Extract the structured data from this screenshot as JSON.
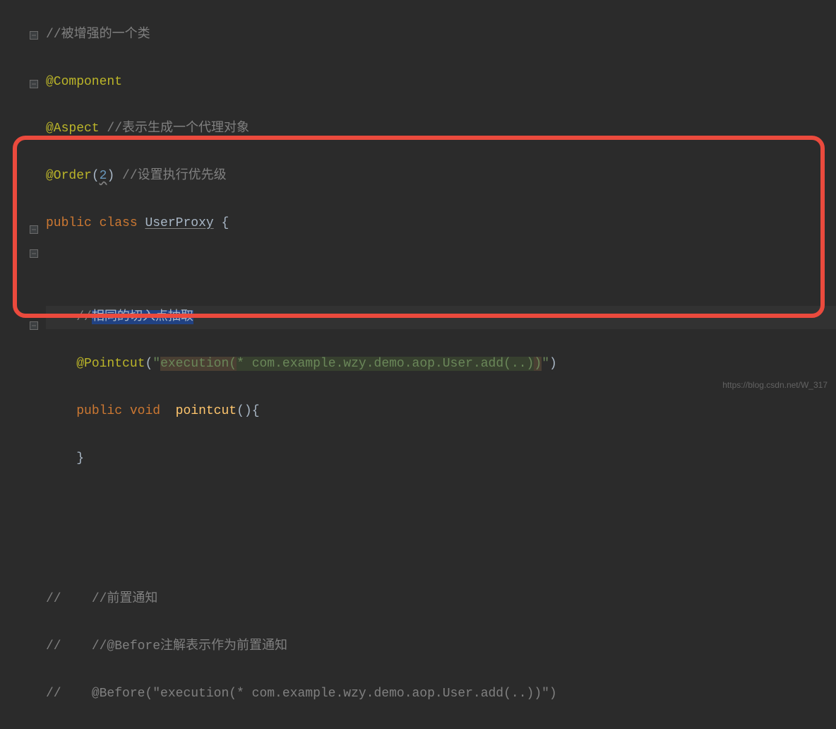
{
  "lines": {
    "l1_comment": "//被增强的一个类",
    "l2_annotation": "@Component",
    "l3_annotation": "@Aspect",
    "l3_comment": " //表示生成一个代理对象",
    "l4_annotation": "@Order",
    "l4_number": "2",
    "l4_comment": " //设置执行优先级",
    "l5_kw_public": "public",
    "l5_kw_class": "class",
    "l5_classname": "UserProxy",
    "l5_brace": " {",
    "l7_prefix": "//",
    "l7_selected": "相同的切入点抽取",
    "l8_annotation": "@Pointcut",
    "l8_open": "(",
    "l8_str_q1": "\"",
    "l8_exec": "execution(",
    "l8_str_rest": "* com.example.wzy.demo.aop.User.add(..)",
    "l8_str_close": ")",
    "l8_str_q2": "\"",
    "l8_close": ")",
    "l9_kw_public": "public",
    "l9_kw_void": "void",
    "l9_method": "pointcut",
    "l9_parens": "(){",
    "l10_brace": "}",
    "l12_slashes": "//",
    "l12_comment": "    //前置通知",
    "l13_slashes": "//",
    "l13_comment": "    //@Before注解表示作为前置通知",
    "l14_slashes": "//",
    "l14_comment": "    @Before(\"execution(* com.example.wzy.demo.aop.User.add(..))\")"
  },
  "watermark": "https://blog.csdn.net/W_317"
}
